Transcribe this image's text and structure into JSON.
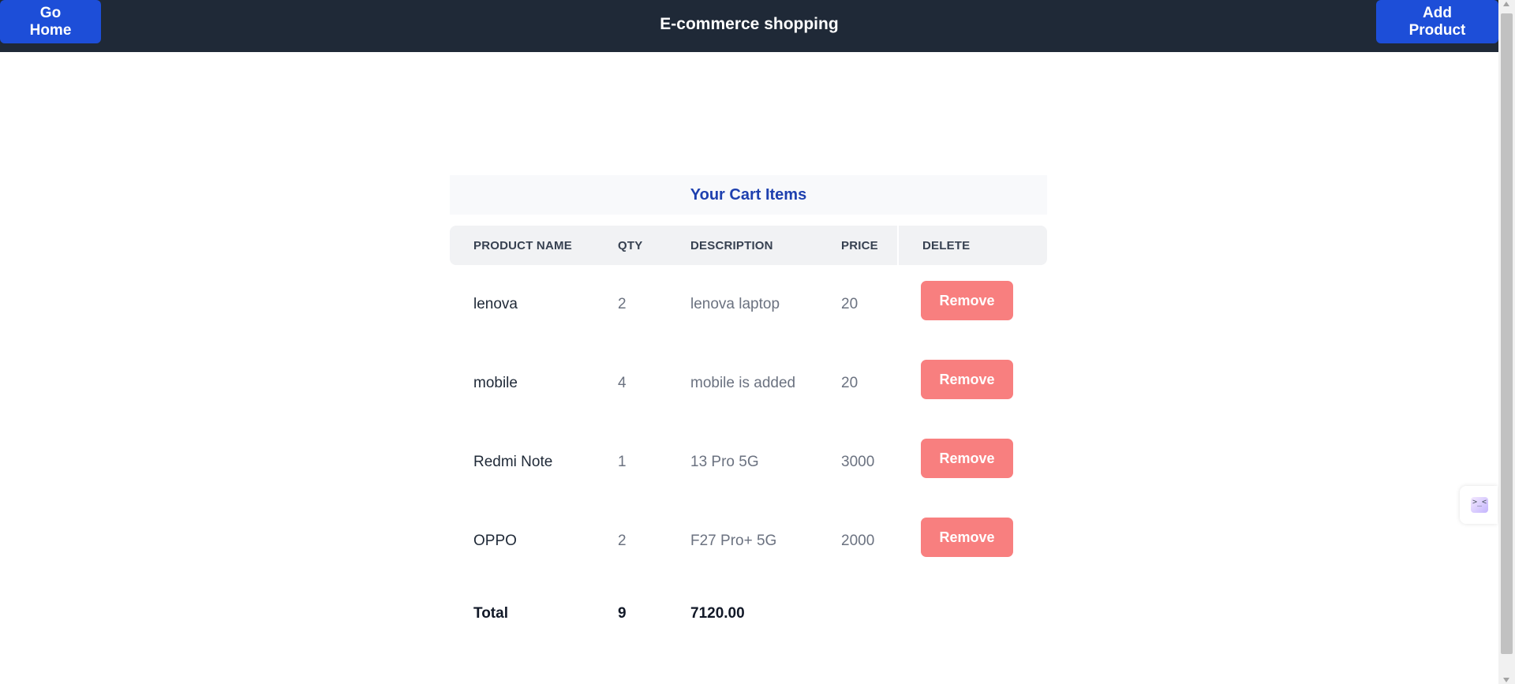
{
  "header": {
    "title": "E-commerce shopping",
    "go_home_label": "Go Home",
    "add_product_label": "Add Product"
  },
  "cart": {
    "title": "Your Cart Items",
    "columns": {
      "product_name": "PRODUCT NAME",
      "qty": "QTY",
      "description": "DESCRIPTION",
      "price": "PRICE",
      "delete": "DELETE"
    },
    "items": [
      {
        "name": "lenova",
        "qty": "2",
        "description": "lenova laptop",
        "price": "20",
        "action": "Remove"
      },
      {
        "name": "mobile",
        "qty": "4",
        "description": "mobile is added",
        "price": "20",
        "action": "Remove"
      },
      {
        "name": "Redmi Note",
        "qty": "1",
        "description": "13 Pro 5G",
        "price": "3000",
        "action": "Remove"
      },
      {
        "name": "OPPO",
        "qty": "2",
        "description": "F27 Pro+ 5G",
        "price": "2000",
        "action": "Remove"
      }
    ],
    "total": {
      "label": "Total",
      "qty": "9",
      "amount": "7120.00"
    }
  },
  "widget": {
    "icon": "chat-face-icon",
    "glyph": ">_<"
  },
  "colors": {
    "header_bg": "#1f2937",
    "primary_button": "#1d4ed8",
    "remove_button": "#f87f7f",
    "cart_title": "#1e40af"
  }
}
